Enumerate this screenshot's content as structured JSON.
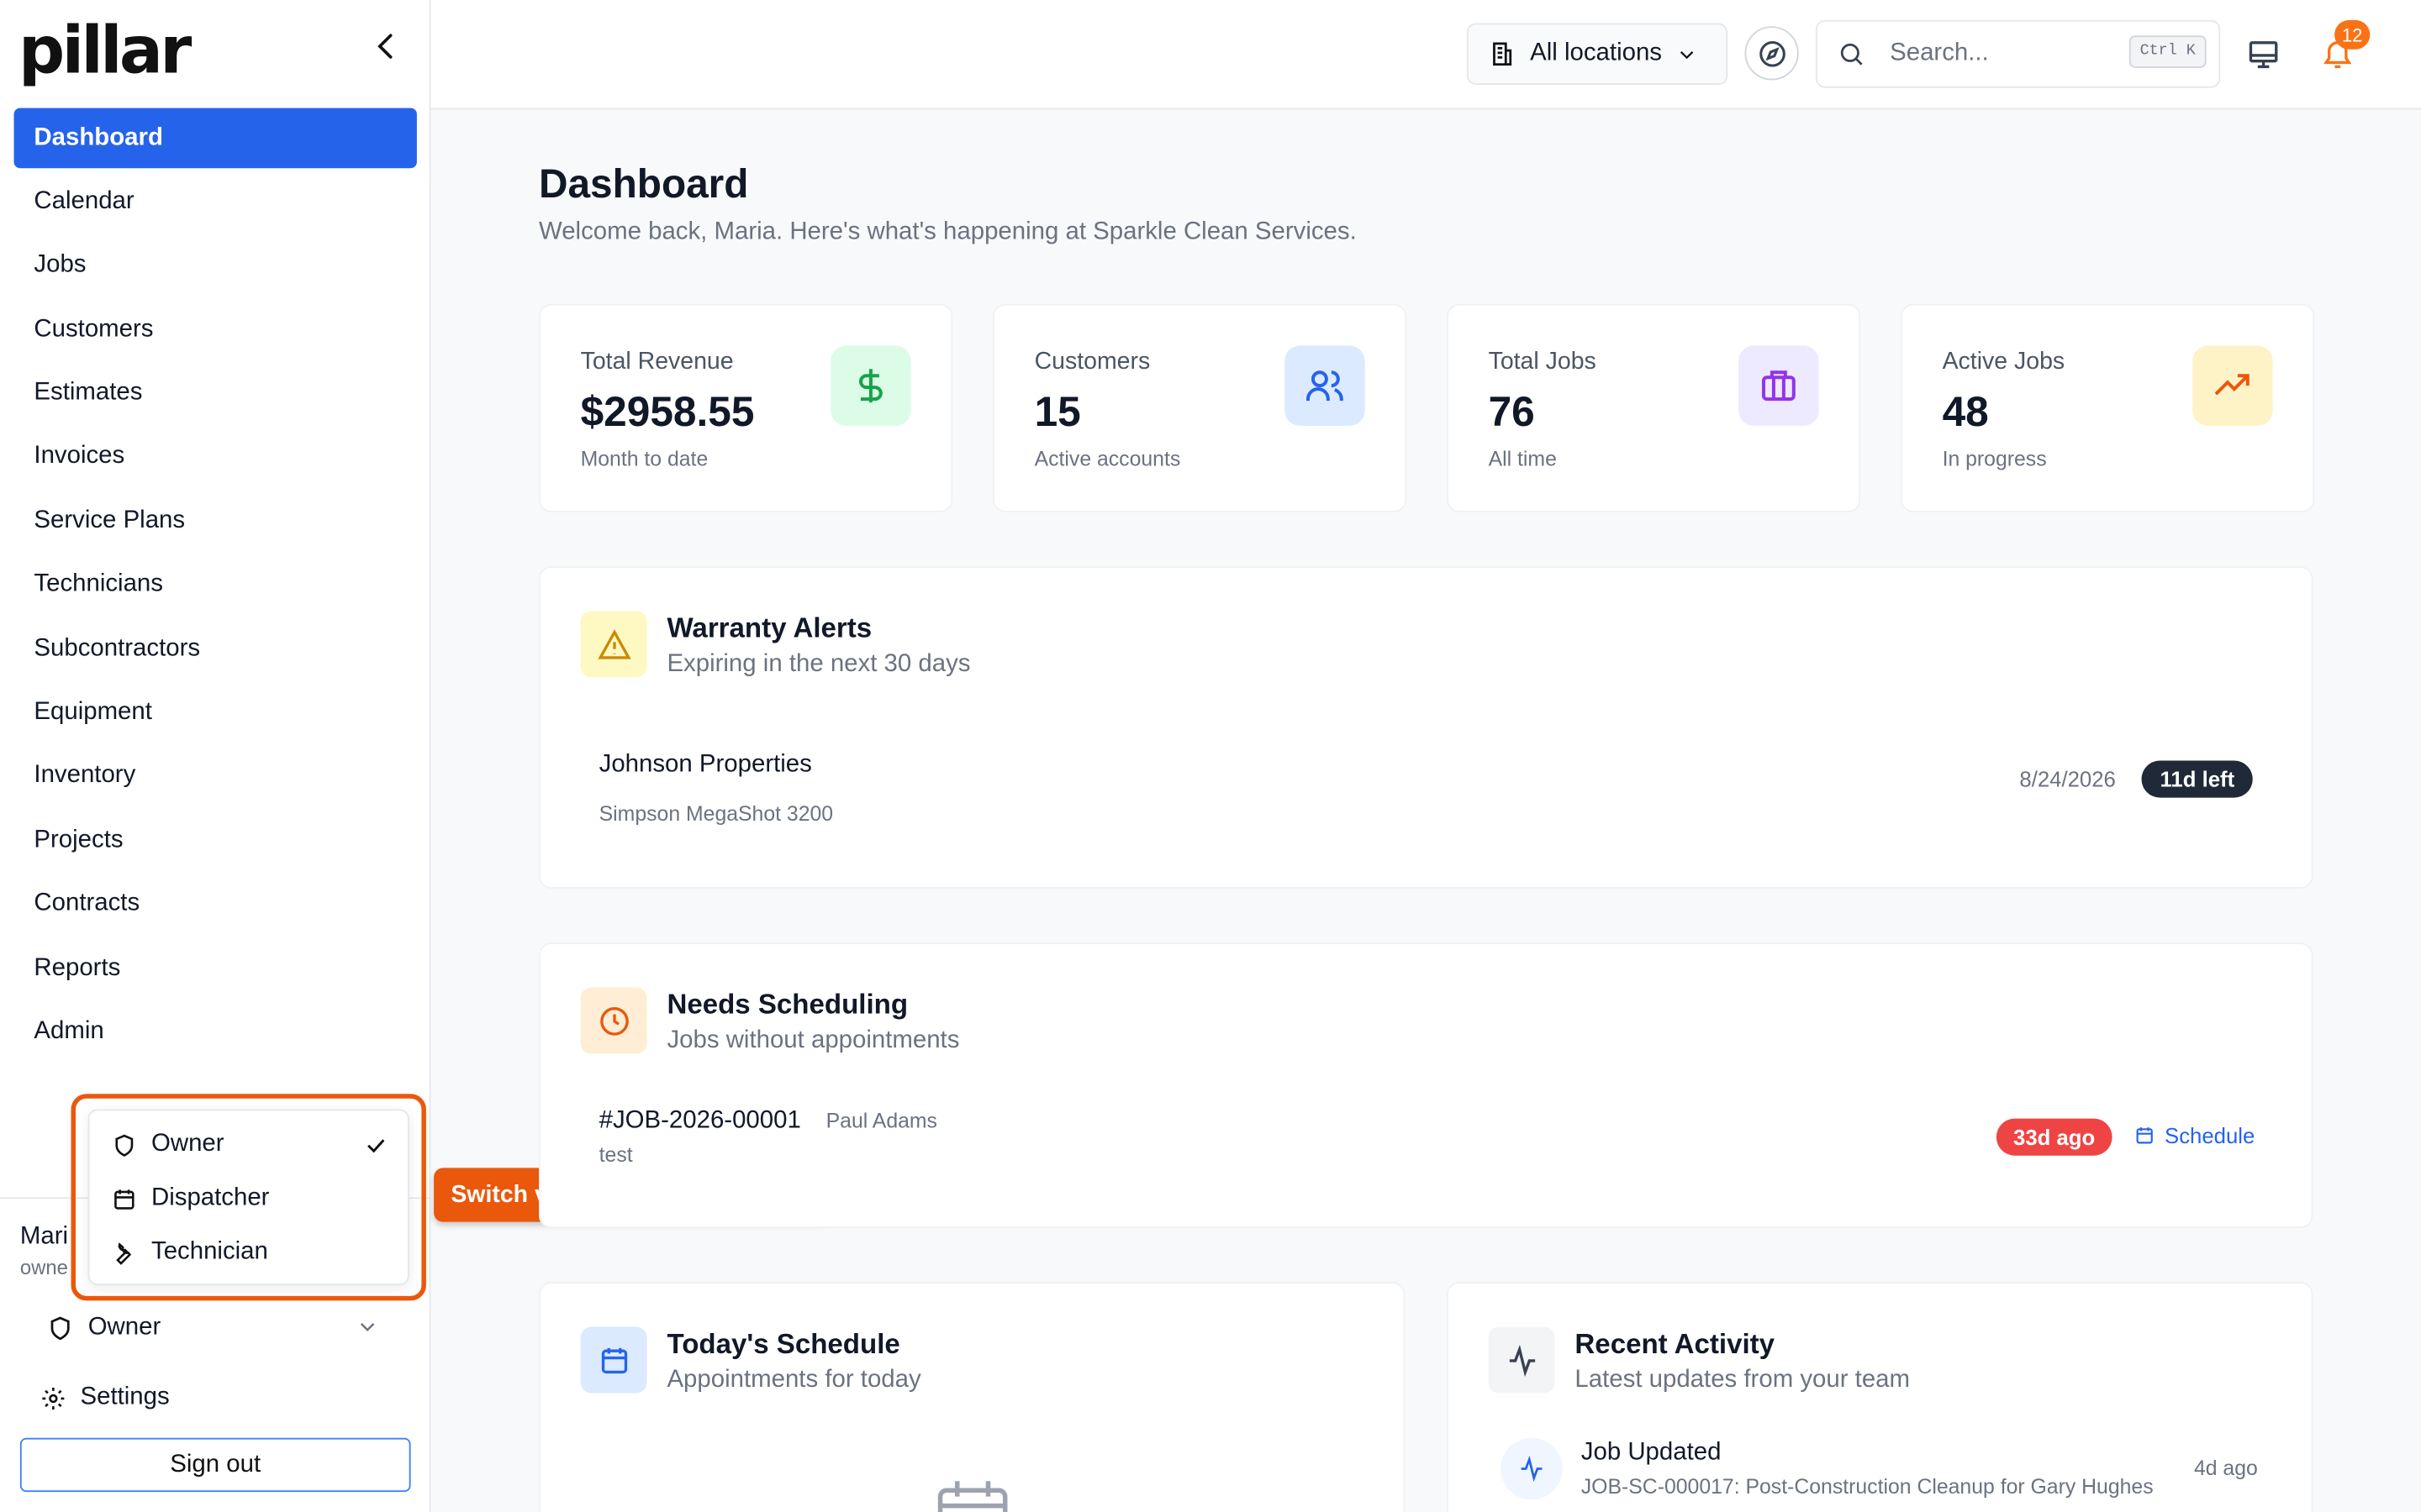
{
  "app": {
    "logo": "pillar"
  },
  "sidebar": {
    "items": [
      {
        "label": "Dashboard",
        "active": true
      },
      {
        "label": "Calendar"
      },
      {
        "label": "Jobs"
      },
      {
        "label": "Customers"
      },
      {
        "label": "Estimates"
      },
      {
        "label": "Invoices"
      },
      {
        "label": "Service Plans"
      },
      {
        "label": "Technicians"
      },
      {
        "label": "Subcontractors"
      },
      {
        "label": "Equipment"
      },
      {
        "label": "Inventory"
      },
      {
        "label": "Projects"
      },
      {
        "label": "Contracts"
      },
      {
        "label": "Reports"
      },
      {
        "label": "Admin"
      }
    ],
    "user_name_partial": "Mari",
    "user_email_partial": "owne",
    "role_current": "Owner",
    "settings_label": "Settings",
    "signout_label": "Sign out"
  },
  "role_menu": {
    "options": [
      {
        "label": "Owner",
        "icon": "shield-icon",
        "selected": true
      },
      {
        "label": "Dispatcher",
        "icon": "calendar-icon"
      },
      {
        "label": "Technician",
        "icon": "wrench-icon"
      }
    ]
  },
  "callout": {
    "text": "Switch view without signing out"
  },
  "topbar": {
    "location_label": "All locations",
    "search_placeholder": "Search...",
    "shortcut": "Ctrl K",
    "notifications_count": "12"
  },
  "page": {
    "title": "Dashboard",
    "subtitle": "Welcome back, Maria. Here's what's happening at Sparkle Clean Services."
  },
  "stats": [
    {
      "label": "Total Revenue",
      "value": "$2958.55",
      "sub": "Month to date",
      "icon": "dollar-icon",
      "color": "#16a34a",
      "bg": "#dcfce7"
    },
    {
      "label": "Customers",
      "value": "15",
      "sub": "Active accounts",
      "icon": "users-icon",
      "color": "#2563eb",
      "bg": "#dbeafe"
    },
    {
      "label": "Total Jobs",
      "value": "76",
      "sub": "All time",
      "icon": "briefcase-icon",
      "color": "#9333ea",
      "bg": "#ede9fe"
    },
    {
      "label": "Active Jobs",
      "value": "48",
      "sub": "In progress",
      "icon": "trending-up-icon",
      "color": "#ea580c",
      "bg": "#fef3c7"
    }
  ],
  "warranty": {
    "title": "Warranty Alerts",
    "subtitle": "Expiring in the next 30 days",
    "item": {
      "customer": "Johnson Properties",
      "equipment": "Simpson MegaShot 3200",
      "date": "8/24/2026",
      "remaining": "11d left"
    }
  },
  "scheduling": {
    "title": "Needs Scheduling",
    "subtitle": "Jobs without appointments",
    "item": {
      "job_id": "#JOB-2026-00001",
      "customer": "Paul Adams",
      "note": "test",
      "age": "33d ago",
      "action": "Schedule"
    }
  },
  "today": {
    "title": "Today's Schedule",
    "subtitle": "Appointments for today"
  },
  "activity": {
    "title": "Recent Activity",
    "subtitle": "Latest updates from your team",
    "item": {
      "title": "Job Updated",
      "detail": "JOB-SC-000017: Post-Construction Cleanup for Gary Hughes",
      "time": "4d ago"
    }
  },
  "colors": {
    "accent": "#2563eb",
    "callout": "#ea580c"
  }
}
